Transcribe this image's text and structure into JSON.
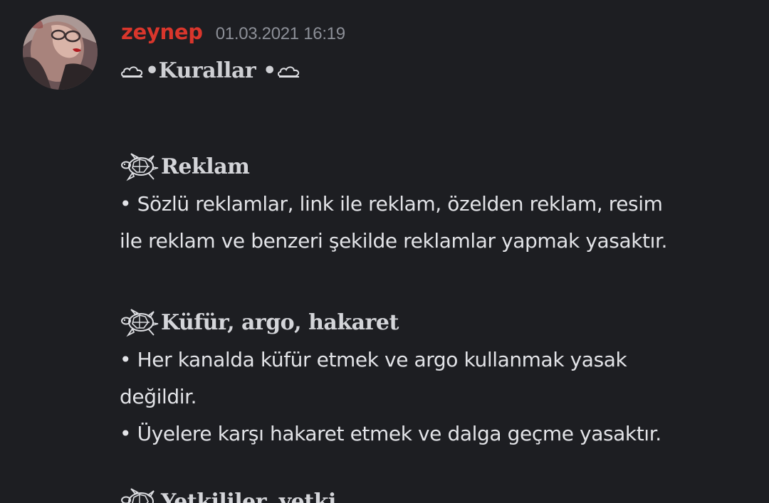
{
  "message": {
    "author": "zeynep",
    "timestamp": "01.03.2021 16:19",
    "title": "•Kurallar •",
    "title_icons": [
      "cloud-icon",
      "cloud-icon"
    ],
    "sections": [
      {
        "icon": "turtle-icon",
        "heading": "Reklam",
        "lines": [
          "• Sözlü reklamlar, link ile reklam, özelden reklam, resim",
          "ile reklam ve benzeri şekilde reklamlar yapmak yasaktır."
        ]
      },
      {
        "icon": "turtle-icon",
        "heading": "Küfür, argo, hakaret",
        "lines": [
          "• Her kanalda küfür etmek ve argo kullanmak yasak",
          "değildir.",
          "• Üyelere karşı hakaret etmek ve dalga geçme yasaktır."
        ]
      },
      {
        "icon": "turtle-icon",
        "heading": "Yetkililer, yetki",
        "lines": []
      }
    ]
  },
  "colors": {
    "background": "#1d1e22",
    "username": "#d9362c",
    "timestamp": "#8c8f97",
    "text": "#e2e3e7"
  }
}
